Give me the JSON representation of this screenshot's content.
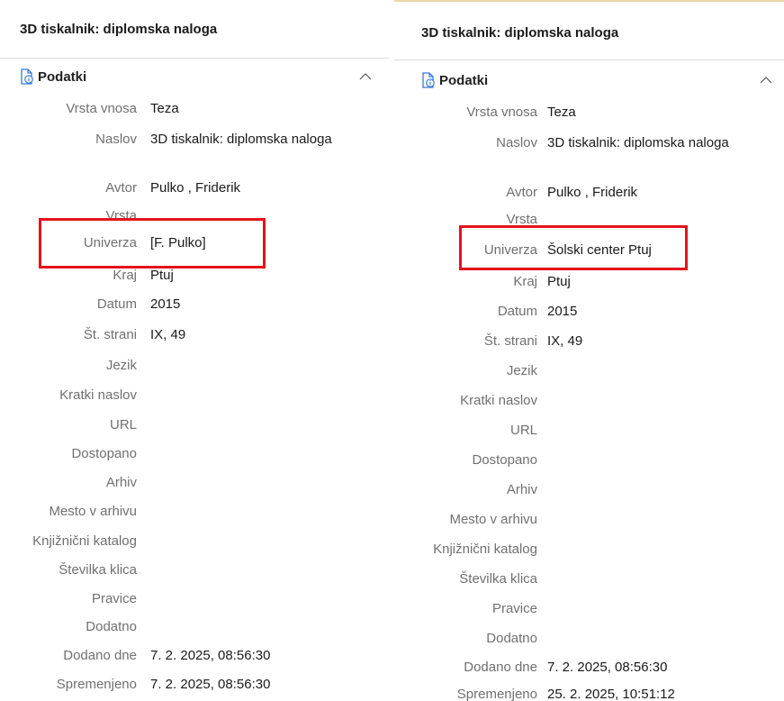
{
  "left_panel": {
    "title": "3D tiskalnik: diplomska naloga",
    "section": {
      "label": "Podatki",
      "icon": "document-info-icon",
      "collapse_icon": "chevron-up-icon"
    },
    "fields": [
      {
        "label": "Vrsta vnosa",
        "value": "Teza"
      },
      {
        "label": "Naslov",
        "value": "3D tiskalnik: diplomska naloga"
      },
      {
        "label": "Avtor",
        "value": "Pulko , Friderik"
      },
      {
        "label": "Vrsta",
        "value": ""
      },
      {
        "label": "Univerza",
        "value": "[F. Pulko]"
      },
      {
        "label": "Kraj",
        "value": "Ptuj"
      },
      {
        "label": "Datum",
        "value": "2015"
      },
      {
        "label": "Št. strani",
        "value": "IX, 49"
      },
      {
        "label": "Jezik",
        "value": ""
      },
      {
        "label": "Kratki naslov",
        "value": ""
      },
      {
        "label": "URL",
        "value": ""
      },
      {
        "label": "Dostopano",
        "value": ""
      },
      {
        "label": "Arhiv",
        "value": ""
      },
      {
        "label": "Mesto v arhivu",
        "value": ""
      },
      {
        "label": "Knjižnični katalog",
        "value": ""
      },
      {
        "label": "Številka klica",
        "value": ""
      },
      {
        "label": "Pravice",
        "value": ""
      },
      {
        "label": "Dodatno",
        "value": ""
      },
      {
        "label": "Dodano dne",
        "value": "7. 2. 2025, 08:56:30"
      },
      {
        "label": "Spremenjeno",
        "value": "7. 2. 2025, 08:56:30"
      }
    ]
  },
  "right_panel": {
    "title": "3D tiskalnik: diplomska naloga",
    "section": {
      "label": "Podatki",
      "icon": "document-info-icon",
      "collapse_icon": "chevron-up-icon"
    },
    "fields": [
      {
        "label": "Vrsta vnosa",
        "value": "Teza"
      },
      {
        "label": "Naslov",
        "value": "3D tiskalnik: diplomska naloga"
      },
      {
        "label": "Avtor",
        "value": "Pulko , Friderik"
      },
      {
        "label": "Vrsta",
        "value": ""
      },
      {
        "label": "Univerza",
        "value": "Šolski center Ptuj"
      },
      {
        "label": "Kraj",
        "value": "Ptuj"
      },
      {
        "label": "Datum",
        "value": "2015"
      },
      {
        "label": "Št. strani",
        "value": "IX, 49"
      },
      {
        "label": "Jezik",
        "value": ""
      },
      {
        "label": "Kratki naslov",
        "value": ""
      },
      {
        "label": "URL",
        "value": ""
      },
      {
        "label": "Dostopano",
        "value": ""
      },
      {
        "label": "Arhiv",
        "value": ""
      },
      {
        "label": "Mesto v arhivu",
        "value": ""
      },
      {
        "label": "Knjižnični katalog",
        "value": ""
      },
      {
        "label": "Številka klica",
        "value": ""
      },
      {
        "label": "Pravice",
        "value": ""
      },
      {
        "label": "Dodatno",
        "value": ""
      },
      {
        "label": "Dodano dne",
        "value": "7. 2. 2025, 08:56:30"
      },
      {
        "label": "Spremenjeno",
        "value": "25. 2. 2025, 10:51:12"
      }
    ]
  },
  "colors": {
    "highlight": "#e4131b",
    "icon_accent": "#3a7bd5",
    "label_gray": "#707070"
  }
}
